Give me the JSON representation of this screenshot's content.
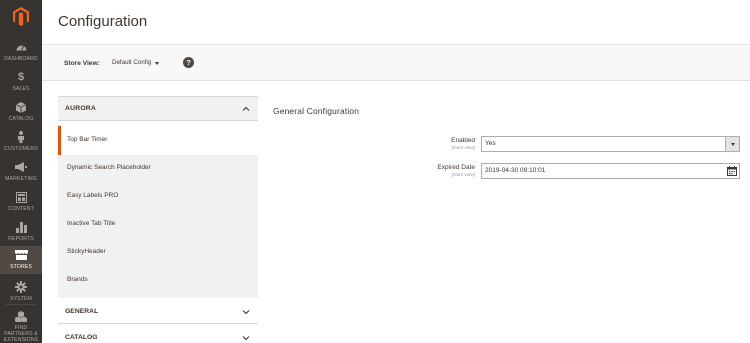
{
  "sidebar": {
    "items": [
      {
        "label": "DASHBOARD",
        "icon": "dashboard-icon"
      },
      {
        "label": "SALES",
        "icon": "dollar-icon"
      },
      {
        "label": "CATALOG",
        "icon": "box-icon"
      },
      {
        "label": "CUSTOMERS",
        "icon": "person-icon"
      },
      {
        "label": "MARKETING",
        "icon": "megaphone-icon"
      },
      {
        "label": "CONTENT",
        "icon": "layout-icon"
      },
      {
        "label": "REPORTS",
        "icon": "bar-chart-icon"
      },
      {
        "label": "STORES",
        "icon": "storefront-icon"
      },
      {
        "label": "SYSTEM",
        "icon": "gear-icon"
      },
      {
        "label": "FIND PARTNERS & EXTENSIONS",
        "icon": "cubes-icon"
      }
    ],
    "active": "STORES"
  },
  "page": {
    "title": "Configuration"
  },
  "store_view": {
    "label": "Store View:",
    "value": "Default Config",
    "help": "?"
  },
  "config_nav": {
    "section_title": "AURORA",
    "items": [
      {
        "label": "Top Bar Timer",
        "active": true
      },
      {
        "label": "Dynamic Search Placeholder"
      },
      {
        "label": "Easy Labels PRO"
      },
      {
        "label": "Inactive Tab Title"
      },
      {
        "label": "StickyHeader"
      },
      {
        "label": "Brands"
      }
    ],
    "collapsed_sections": [
      "GENERAL",
      "CATALOG"
    ]
  },
  "main": {
    "section_title": "General Configuration",
    "fields": [
      {
        "label": "Enabled",
        "scope": "[store view]",
        "value": "Yes",
        "type": "select"
      },
      {
        "label": "Expired Date",
        "scope": "[store view]",
        "value": "2019-04-30 09:10:01",
        "type": "date"
      }
    ]
  },
  "colors": {
    "menu_bg": "#373330",
    "menu_active": "#514943",
    "accent": "#eb5202",
    "logo": "#f26322"
  }
}
